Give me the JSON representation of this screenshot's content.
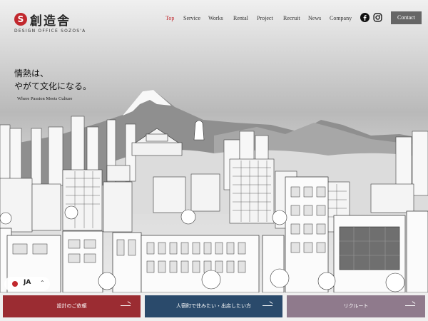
{
  "logo": {
    "name": "創造舎",
    "sub": "DESIGN OFFICE SOZOS'A",
    "mark": "S"
  },
  "nav": {
    "items": [
      "Top",
      "Service",
      "Works",
      "Rental",
      "Project",
      "Recruit",
      "News",
      "Company"
    ],
    "active": "Top",
    "contact": "Contact"
  },
  "hero": {
    "tagline_line1": "情熱は、",
    "tagline_line2": "やがて文化になる。",
    "tagline_en": "Where Passion Meets Culture"
  },
  "lang": {
    "code": "JA"
  },
  "cta": [
    {
      "label": "設計のご依頼",
      "color": "#9b2c32"
    },
    {
      "label": "人宿町で住みたい・出店したい方",
      "color": "#2a4a6b"
    },
    {
      "label": "リクルート",
      "color": "#8f7a8c"
    }
  ],
  "colors": {
    "accent": "#c1282e",
    "contact_bg": "#666666"
  },
  "icons": {
    "social": [
      "facebook-icon",
      "instagram-icon"
    ],
    "lang": "flag-icon"
  }
}
